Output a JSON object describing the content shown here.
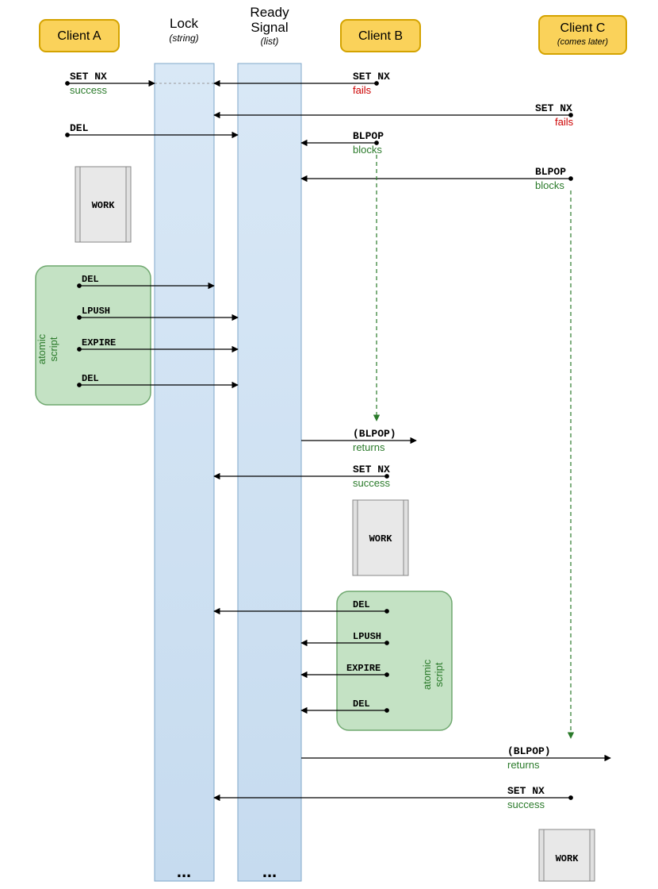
{
  "headers": {
    "clientA": "Client A",
    "lock": "Lock",
    "lock_sub": "(string)",
    "ready": "Ready\nSignal",
    "ready_sub": "(list)",
    "clientB": "Client B",
    "clientC": "Client C",
    "clientC_sub": "(comes later)"
  },
  "labels": {
    "setnx": "SET NX",
    "del": "DEL",
    "blpop": "BLPOP",
    "blpop_ret": "(BLPOP)",
    "lpush": "LPUSH",
    "expire": "EXPIRE",
    "work": "WORK",
    "atomic_script": "atomic\nscript",
    "ellipsis": "..."
  },
  "status": {
    "success": "success",
    "fails": "fails",
    "blocks": "blocks",
    "returns": "returns"
  },
  "colors": {
    "clientBox": "#fad25a",
    "clientBoxBorder": "#d4a300",
    "lifeline": "#c6dbef",
    "lifelineBorder": "#7fa7c9",
    "scriptBox": "#c4e2c4",
    "scriptBoxBorder": "#6fa86f",
    "workFill": "#e0e0e0",
    "green": "#2a7a2a",
    "red": "#cc0000"
  },
  "chart_data": {
    "type": "sequence-diagram",
    "lanes": [
      "Client A",
      "Lock (string)",
      "Ready Signal (list)",
      "Client B",
      "Client C (comes later)"
    ],
    "events": [
      {
        "from": "Client A",
        "to": "Lock",
        "op": "SET NX",
        "result": "success"
      },
      {
        "from": "Client B",
        "to": "Lock",
        "op": "SET NX",
        "result": "fails"
      },
      {
        "from": "Client C",
        "to": "Lock",
        "op": "SET NX",
        "result": "fails"
      },
      {
        "from": "Client A",
        "to": "Ready Signal",
        "op": "DEL"
      },
      {
        "from": "Client B",
        "to": "Ready Signal",
        "op": "BLPOP",
        "result": "blocks"
      },
      {
        "from": "Client C",
        "to": "Ready Signal",
        "op": "BLPOP",
        "result": "blocks"
      },
      {
        "lane": "Client A",
        "op": "WORK"
      },
      {
        "lane": "Client A",
        "group": "atomic script",
        "ops": [
          {
            "to": "Lock",
            "op": "DEL"
          },
          {
            "to": "Ready Signal",
            "op": "LPUSH"
          },
          {
            "to": "Ready Signal",
            "op": "EXPIRE"
          },
          {
            "to": "Ready Signal",
            "op": "DEL"
          }
        ]
      },
      {
        "from": "Ready Signal",
        "to": "Client B",
        "op": "(BLPOP)",
        "result": "returns"
      },
      {
        "from": "Client B",
        "to": "Lock",
        "op": "SET NX",
        "result": "success"
      },
      {
        "lane": "Client B",
        "op": "WORK"
      },
      {
        "lane": "Client B",
        "group": "atomic script",
        "ops": [
          {
            "to": "Lock",
            "op": "DEL"
          },
          {
            "to": "Ready Signal",
            "op": "LPUSH"
          },
          {
            "to": "Ready Signal",
            "op": "EXPIRE"
          },
          {
            "to": "Ready Signal",
            "op": "DEL"
          }
        ]
      },
      {
        "from": "Ready Signal",
        "to": "Client C",
        "op": "(BLPOP)",
        "result": "returns"
      },
      {
        "from": "Client C",
        "to": "Lock",
        "op": "SET NX",
        "result": "success"
      },
      {
        "lane": "Client C",
        "op": "WORK"
      }
    ]
  }
}
